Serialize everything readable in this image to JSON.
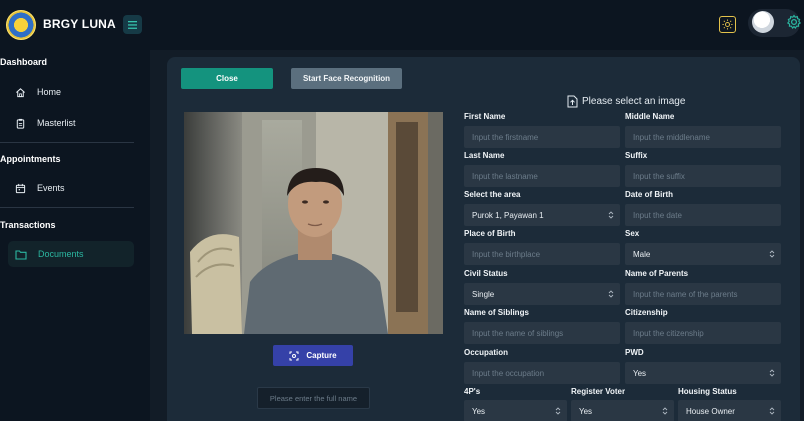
{
  "app": {
    "brand": "BRGY LUNA"
  },
  "sidebar": {
    "sections": [
      {
        "label": "Dashboard"
      },
      {
        "label": "Appointments"
      },
      {
        "label": "Transactions"
      }
    ],
    "items": [
      {
        "label": "Home",
        "icon": "home-icon"
      },
      {
        "label": "Masterlist",
        "icon": "clipboard-icon"
      },
      {
        "label": "Events",
        "icon": "calendar-icon"
      },
      {
        "label": "Documents",
        "icon": "folder-icon",
        "active": true
      }
    ]
  },
  "toolbar": {
    "close_label": "Close",
    "face_recognition_label": "Start Face Recognition"
  },
  "camera": {
    "capture_label": "Capture",
    "fullname_placeholder": "Please enter the full name"
  },
  "form": {
    "select_image_label": "Please select an image",
    "first_name": {
      "label": "First Name",
      "placeholder": "Input the firstname"
    },
    "middle_name": {
      "label": "Middle Name",
      "placeholder": "Input the middlename"
    },
    "last_name": {
      "label": "Last Name",
      "placeholder": "Input the lastname"
    },
    "suffix": {
      "label": "Suffix",
      "placeholder": "Input the suffix"
    },
    "area": {
      "label": "Select the area",
      "value": "Purok 1, Payawan 1"
    },
    "date_of_birth": {
      "label": "Date of Birth",
      "placeholder": "Input the date"
    },
    "place_of_birth": {
      "label": "Place of Birth",
      "placeholder": "Input the birthplace"
    },
    "sex": {
      "label": "Sex",
      "value": "Male"
    },
    "civil_status": {
      "label": "Civil Status",
      "value": "Single"
    },
    "parents": {
      "label": "Name of Parents",
      "placeholder": "Input the name of the parents"
    },
    "siblings": {
      "label": "Name of Siblings",
      "placeholder": "Input the name of siblings"
    },
    "citizenship": {
      "label": "Citizenship",
      "placeholder": "Input the citizenship"
    },
    "occupation": {
      "label": "Occupation",
      "placeholder": "Input the occupation"
    },
    "pwd": {
      "label": "PWD",
      "value": "Yes"
    },
    "four_ps": {
      "label": "4P's",
      "value": "Yes"
    },
    "register_voter": {
      "label": "Register Voter",
      "value": "Yes"
    },
    "housing_status": {
      "label": "Housing Status",
      "value": "House Owner"
    }
  },
  "colors": {
    "accent": "#14937e",
    "active_text": "#2bb7a1",
    "capture": "#3541a8",
    "card": "#1c2b39",
    "field": "#2a3744"
  }
}
